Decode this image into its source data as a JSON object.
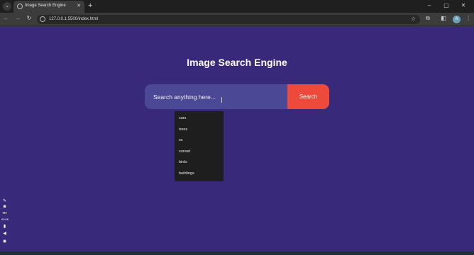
{
  "browser": {
    "tab_title": "Image Search Engine",
    "url": "127.0.0.1:5500/index.html",
    "profile_initial": "A",
    "icons": [
      "tab-search-icon",
      "favicon-icon",
      "close-icon",
      "new-tab-icon",
      "minimize-icon",
      "maximize-icon",
      "window-close-icon",
      "back-icon",
      "forward-icon",
      "reload-icon",
      "site-info-icon",
      "star-icon",
      "extensions-icon",
      "side-panel-icon",
      "menu-icon"
    ]
  },
  "page": {
    "title": "Image Search Engine",
    "search": {
      "placeholder": "Search anything here...",
      "button_label": "Search"
    },
    "suggestions": [
      "cars",
      "trees",
      "ss",
      "sunset",
      "birds",
      "buildings"
    ],
    "colors": {
      "background": "#38297a",
      "search_bar": "#4b4896",
      "button": "#ee4a3c",
      "dropdown": "#1e1e1e"
    }
  },
  "overlay": {
    "timer": "00:06"
  }
}
